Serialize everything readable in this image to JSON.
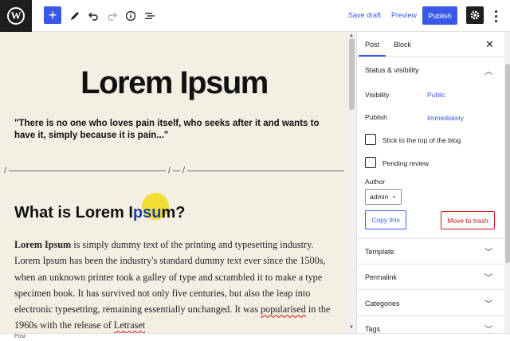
{
  "toolbar": {
    "logo_letter": "W",
    "save_draft": "Save draft",
    "preview": "Preview",
    "publish": "Publish"
  },
  "editor": {
    "title": "Lorem Ipsum",
    "quote": "\"There is no one who loves pain itself, who seeks after it and wants to have it, simply because it is pain...\"",
    "separator_mark": "/",
    "heading_pre": "What is Lorem I",
    "heading_sel": "psu",
    "heading_post": "m?",
    "para_bold": "Lorem Ipsum",
    "para_text_1": " is simply dummy text of the printing and typesetting industry. Lorem Ipsum has been the industry's standard dummy text ever since the 1500s, when an unknown printer took a galley of type and scrambled it to make a type specimen book. It has survived not only five centuries, but also the leap into electronic typesetting, remaining essentially unchanged. It was ",
    "para_underlined": "popularised",
    "para_text_2": " in the 1960s with the release of ",
    "para_underlined_2": "Letraset"
  },
  "sidebar": {
    "tab_post": "Post",
    "tab_block": "Block",
    "status_title": "Status & visibility",
    "visibility_label": "Visibility",
    "visibility_value": "Public",
    "publish_label": "Publish",
    "publish_value": "Immediately",
    "stick_label": "Stick to the top of the blog",
    "pending_label": "Pending review",
    "author_label": "Author",
    "author_value": "admin",
    "copy_label": "Copy this",
    "trash_label": "Move to trash",
    "sections": [
      "Template",
      "Permalink",
      "Categories",
      "Tags"
    ]
  },
  "footer": {
    "breadcrumb": "Post"
  },
  "colors": {
    "accent": "#3858e9",
    "danger": "#cc1818",
    "canvas_bg": "#f4efe3"
  }
}
